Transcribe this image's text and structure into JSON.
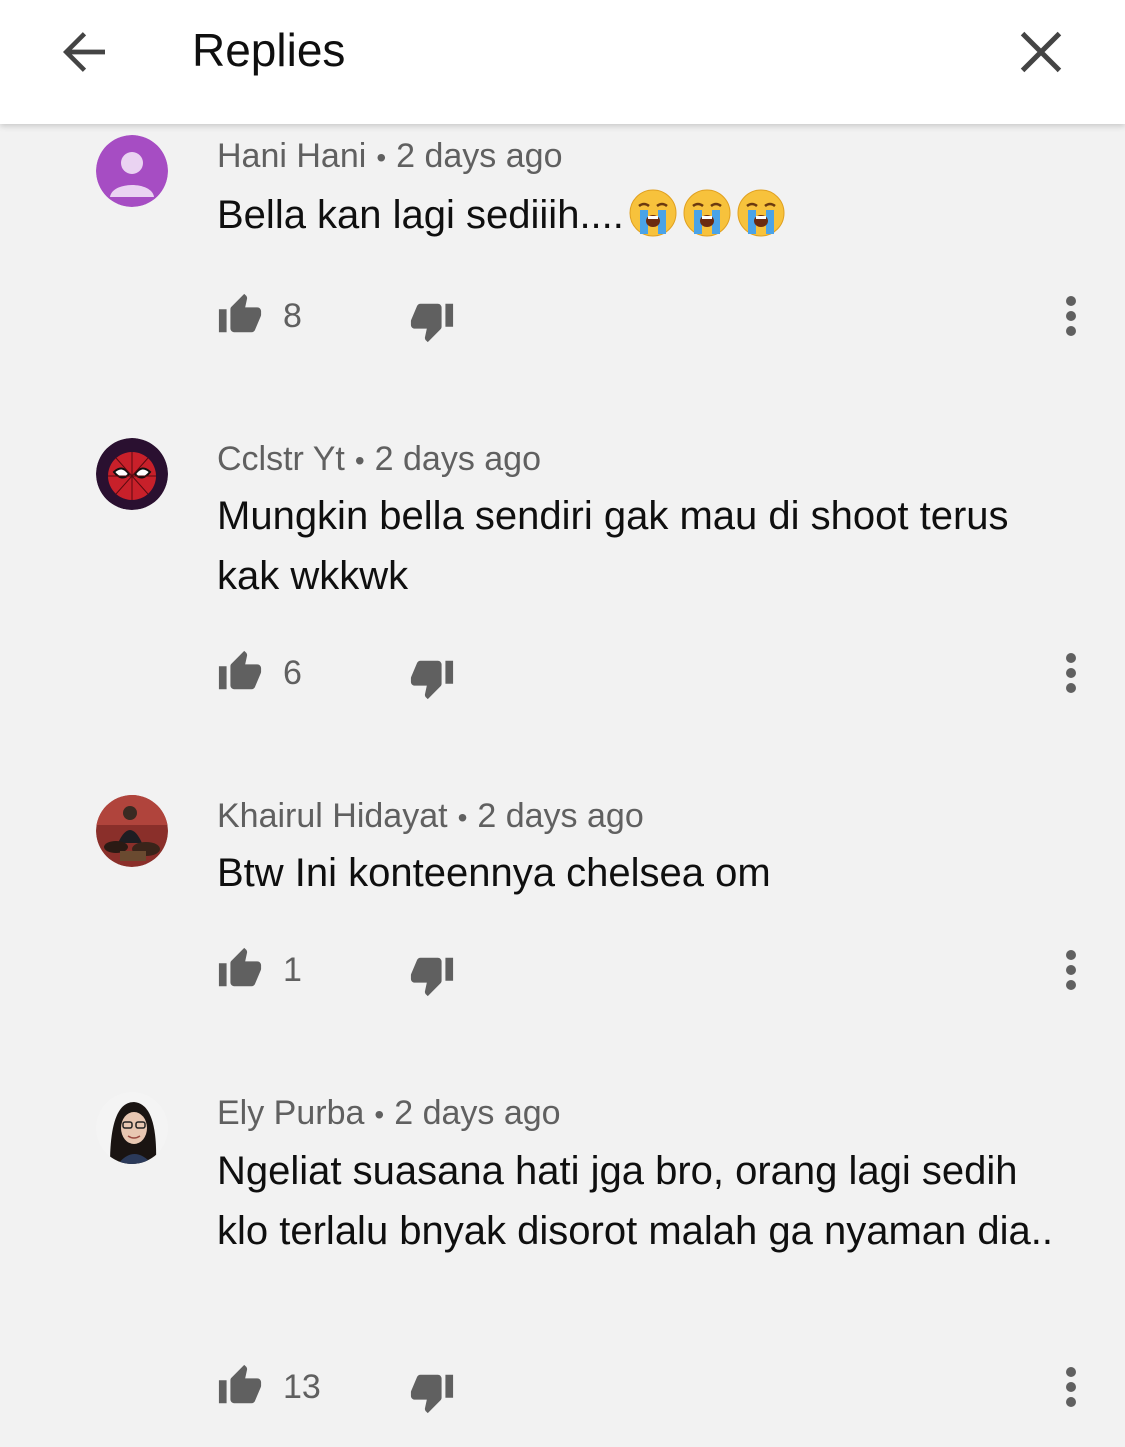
{
  "header": {
    "title": "Replies",
    "back_icon": "arrow-left-icon",
    "close_icon": "close-icon"
  },
  "comments": [
    {
      "author": "Hani Hani",
      "separator": "•",
      "time": "2 days ago",
      "text": "Bella kan lagi sediiih....",
      "emoji": [
        "loudly-crying-face",
        "loudly-crying-face",
        "loudly-crying-face"
      ],
      "likes": "8",
      "avatar": "default-person-avatar"
    },
    {
      "author": "Cclstr Yt",
      "separator": "•",
      "time": "2 days ago",
      "text": "Mungkin bella sendiri gak mau di shoot terus kak wkkwk",
      "likes": "6",
      "avatar": "spiderman-avatar"
    },
    {
      "author": "Khairul Hidayat",
      "separator": "•",
      "time": "2 days ago",
      "text": "Btw Ini konteennya chelsea om",
      "likes": "1",
      "avatar": "photo-avatar-drummer"
    },
    {
      "author": "Ely Purba",
      "separator": "•",
      "time": "2 days ago",
      "text": "Ngeliat suasana hati jga bro, orang lagi sedih klo terlalu bnyak disorot malah ga nyaman dia..",
      "likes": "13",
      "avatar": "photo-avatar-woman"
    }
  ],
  "colors": {
    "background": "#f2f2f2",
    "header_bg": "#ffffff",
    "secondary_text": "#606060",
    "icon": "#606060",
    "default_avatar": "#a64dc3"
  }
}
